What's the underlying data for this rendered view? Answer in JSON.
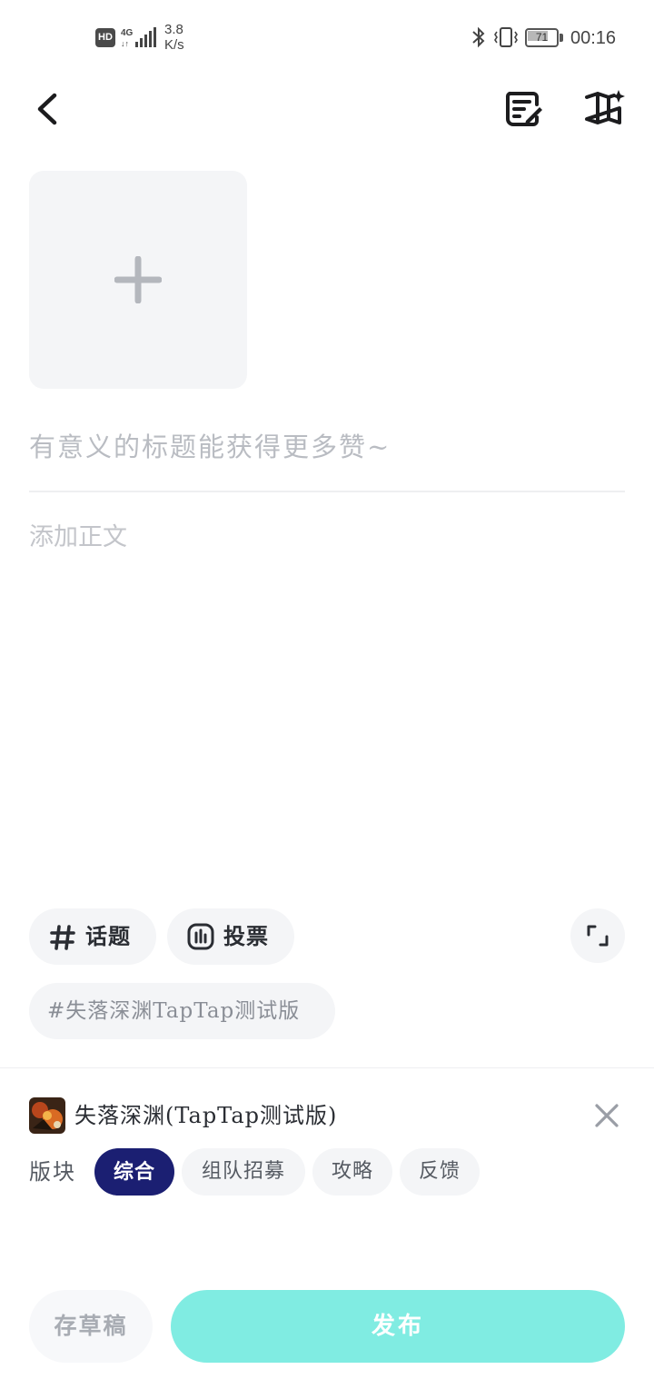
{
  "status_bar": {
    "hd": "HD",
    "network": "4G",
    "speed_value": "3.8",
    "speed_unit": "K/s",
    "battery": "71",
    "battery_level": 0.71,
    "time": "00:16"
  },
  "header": {
    "back_icon": "chevron-left-icon",
    "draft_box_icon": "draft-edit-icon",
    "guide_icon": "book-sparkle-icon"
  },
  "composer": {
    "add_image_icon": "plus-icon",
    "title_placeholder": "有意义的标题能获得更多赞~",
    "title_value": "",
    "body_placeholder": "添加正文",
    "body_value": ""
  },
  "tools": {
    "topic_label": "话题",
    "topic_icon": "hashtag-icon",
    "vote_label": "投票",
    "vote_icon": "vote-chart-icon",
    "expand_icon": "expand-icon",
    "selected_tag": "#失落深渊TapTap测试版"
  },
  "game": {
    "name": "失落深渊(TapTap测试版)",
    "close_icon": "close-icon"
  },
  "board": {
    "label": "版块",
    "options": [
      "综合",
      "组队招募",
      "攻略",
      "反馈"
    ],
    "selected": "综合"
  },
  "actions": {
    "save_draft": "存草稿",
    "publish": "发布"
  },
  "colors": {
    "accent_dark": "#1b1f72",
    "publish_bg": "#80ece2",
    "chip_bg": "#f4f5f7"
  }
}
